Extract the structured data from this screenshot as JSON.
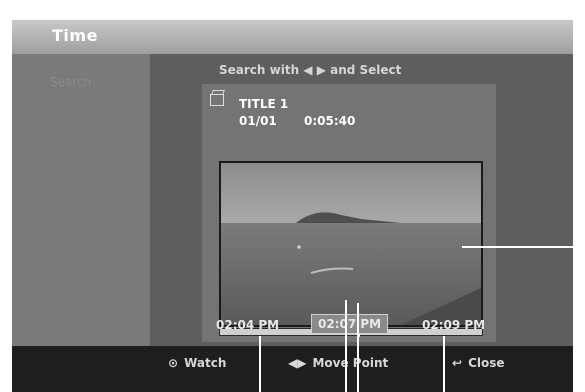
{
  "header": {
    "title": "Time"
  },
  "sidebar": {
    "items": [
      {
        "label": "Search"
      }
    ]
  },
  "main": {
    "instruction": "Search with ◀ ▶ and Select"
  },
  "card": {
    "title": "TITLE 1",
    "date": "01/01",
    "duration": "0:05:40",
    "icon": "clapperboard-icon"
  },
  "timeline": {
    "start": "02:04 PM",
    "selected": "02:07 PM",
    "end": "02:09 PM",
    "position_fraction": 0.53
  },
  "footer": {
    "watch": {
      "label": "Watch",
      "icon": "disc-icon"
    },
    "move": {
      "label": "Move Point",
      "icon": "left-right-arrows-icon"
    },
    "close": {
      "label": "Close",
      "icon": "return-icon"
    }
  }
}
